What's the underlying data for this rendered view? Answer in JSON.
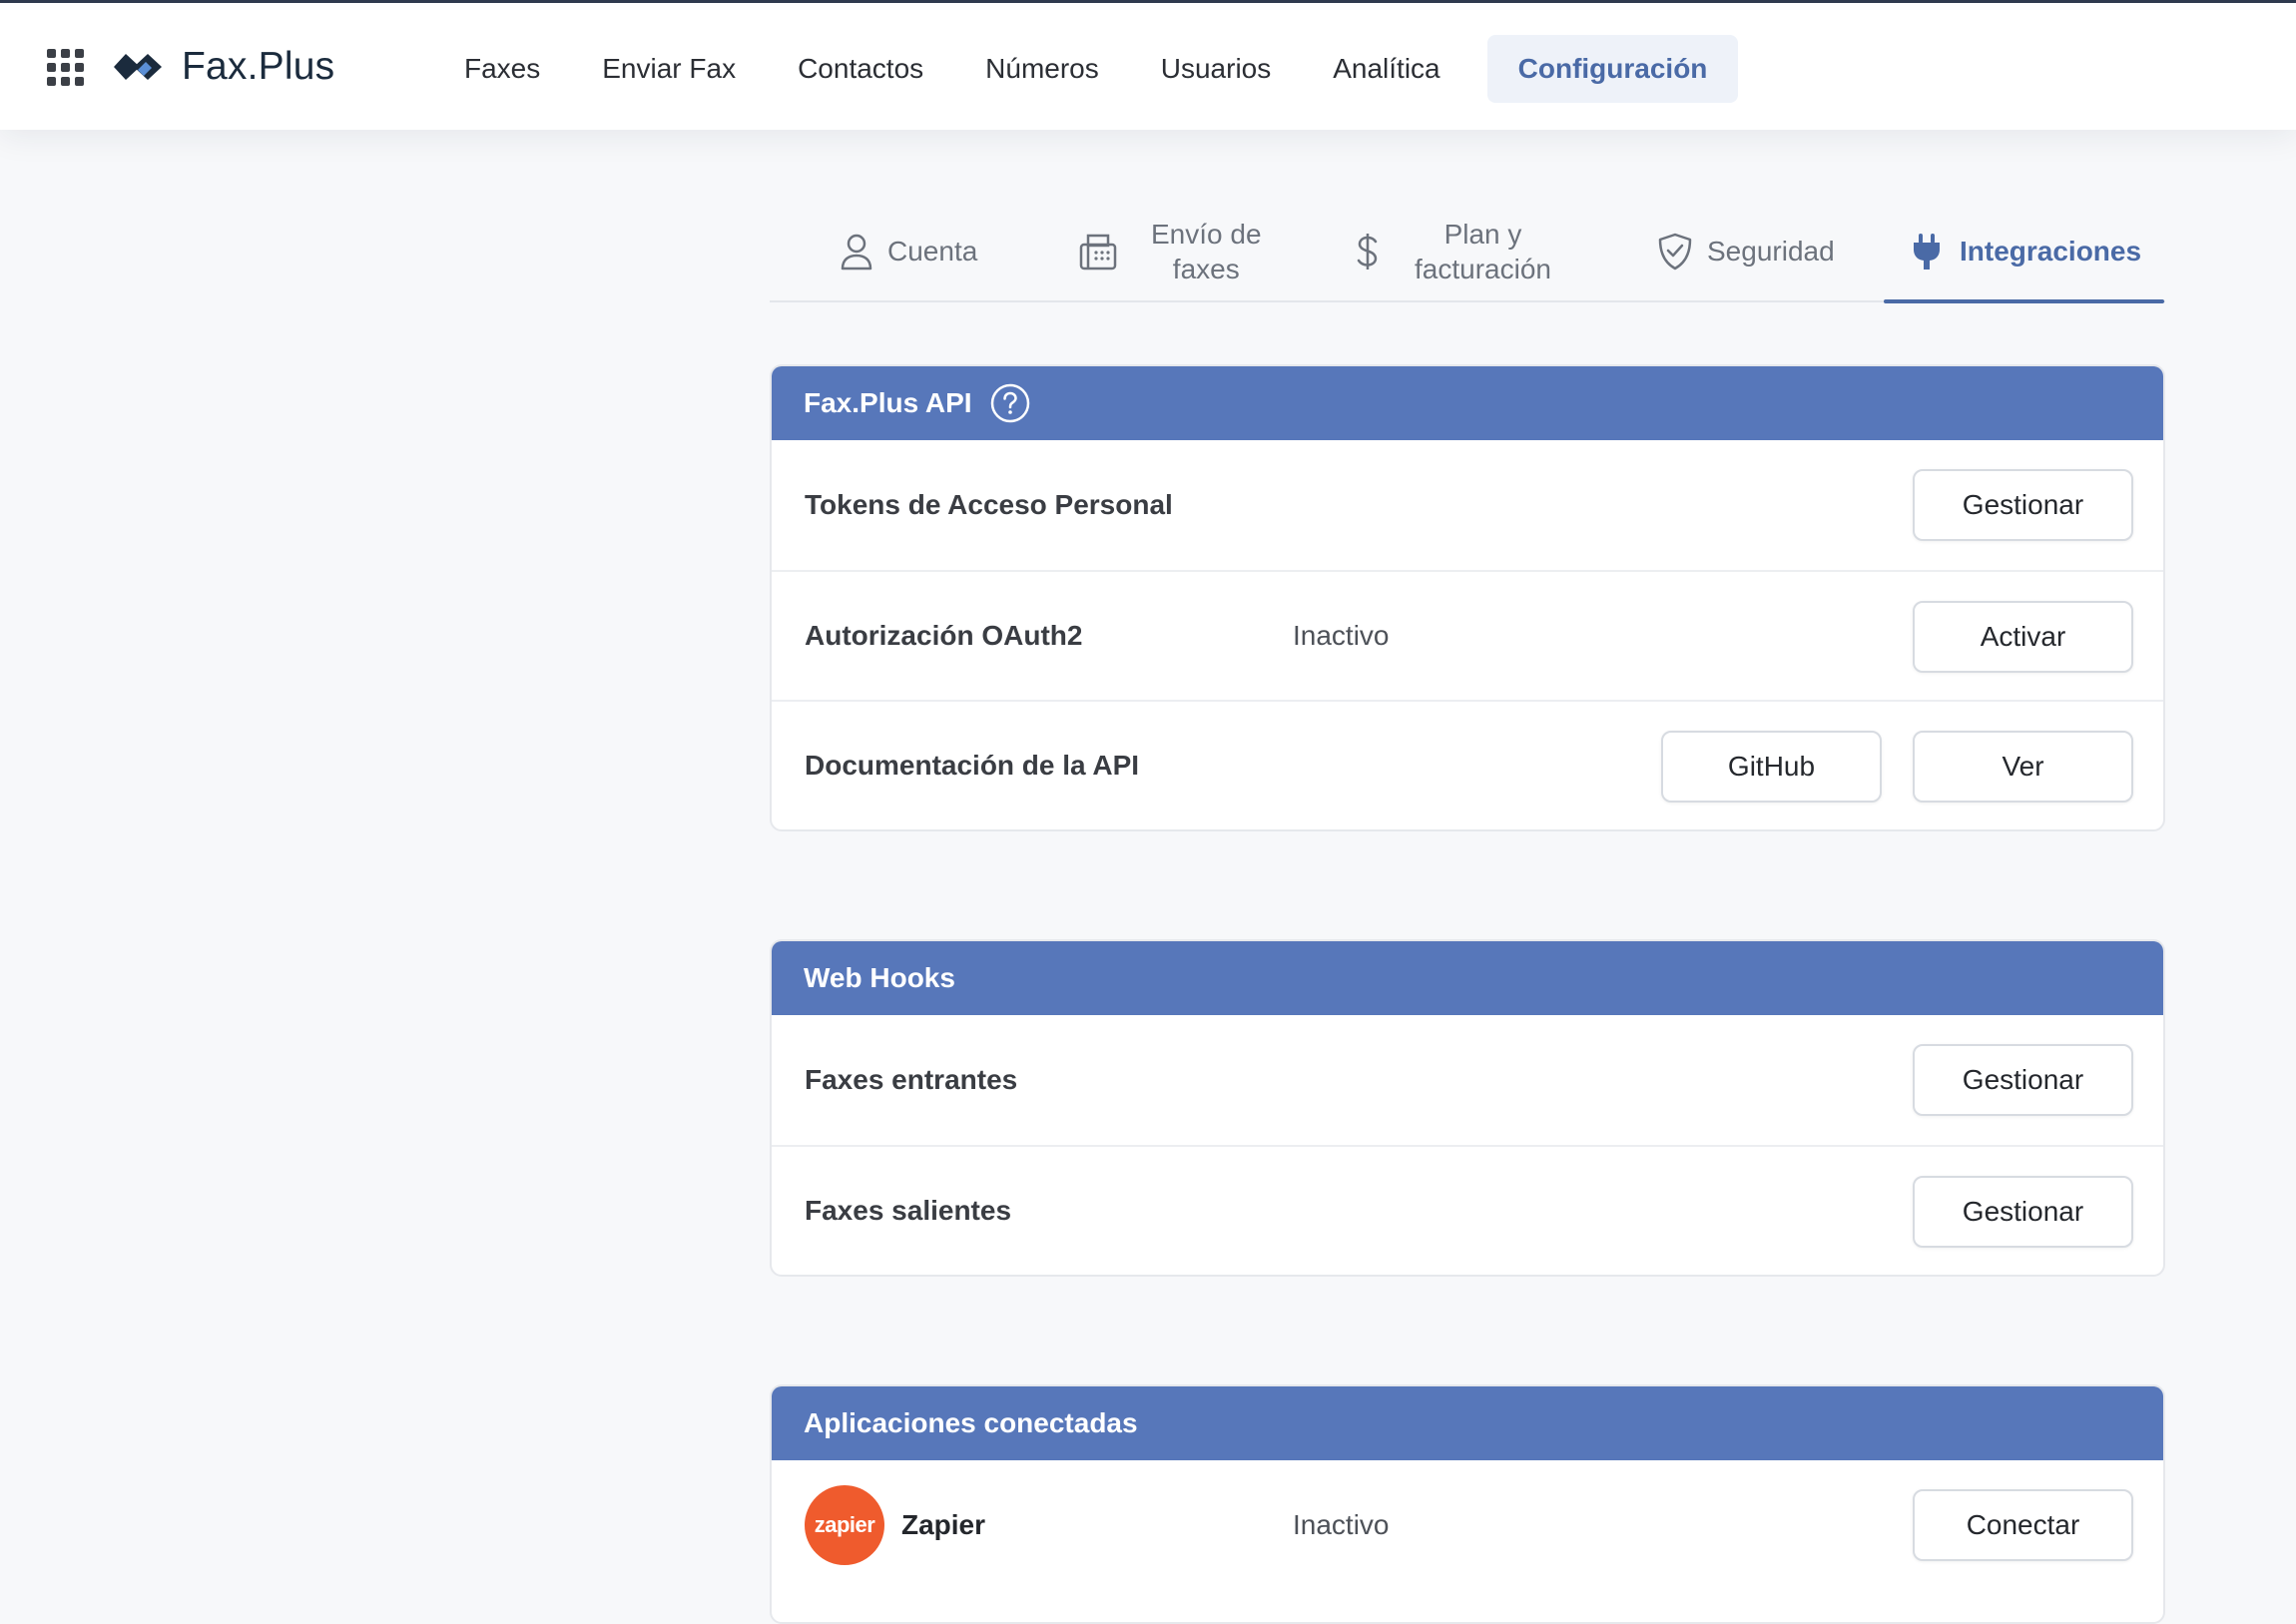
{
  "header": {
    "grid_icon": "apps-grid-icon",
    "logo_icon": "fax-plus-logo-icon",
    "logo_text": "Fax.Plus",
    "nav": [
      {
        "label": "Faxes"
      },
      {
        "label": "Enviar Fax"
      },
      {
        "label": "Contactos"
      },
      {
        "label": "Números"
      },
      {
        "label": "Usuarios"
      },
      {
        "label": "Analítica"
      },
      {
        "label": "Configuración",
        "active": true
      }
    ]
  },
  "tabs": [
    {
      "label": "Cuenta",
      "icon": "user-icon"
    },
    {
      "label_line1": "Envío de",
      "label_line2": "faxes",
      "icon": "fax-machine-icon"
    },
    {
      "label_line1": "Plan y",
      "label_line2": "facturación",
      "icon": "dollar-icon"
    },
    {
      "label": "Seguridad",
      "icon": "shield-check-icon"
    },
    {
      "label": "Integraciones",
      "icon": "plug-icon",
      "active": true
    }
  ],
  "api_card": {
    "title": "Fax.Plus API",
    "help_icon": "help-circle-icon",
    "rows": [
      {
        "label": "Tokens de Acceso Personal",
        "button": "Gestionar"
      },
      {
        "label": "Autorización OAuth2",
        "status": "Inactivo",
        "button": "Activar"
      },
      {
        "label": "Documentación de la API",
        "button_secondary": "GitHub",
        "button": "Ver"
      }
    ]
  },
  "webhooks_card": {
    "title": "Web Hooks",
    "rows": [
      {
        "label": "Faxes entrantes",
        "button": "Gestionar"
      },
      {
        "label": "Faxes salientes",
        "button": "Gestionar"
      }
    ]
  },
  "apps_card": {
    "title": "Aplicaciones conectadas",
    "rows": [
      {
        "logo_text": "zapier",
        "label": "Zapier",
        "status": "Inactivo",
        "button": "Conectar"
      }
    ]
  },
  "colors": {
    "accent": "#4a6aa6",
    "card_header": "#5777ba",
    "zapier": "#ef5b2d"
  }
}
